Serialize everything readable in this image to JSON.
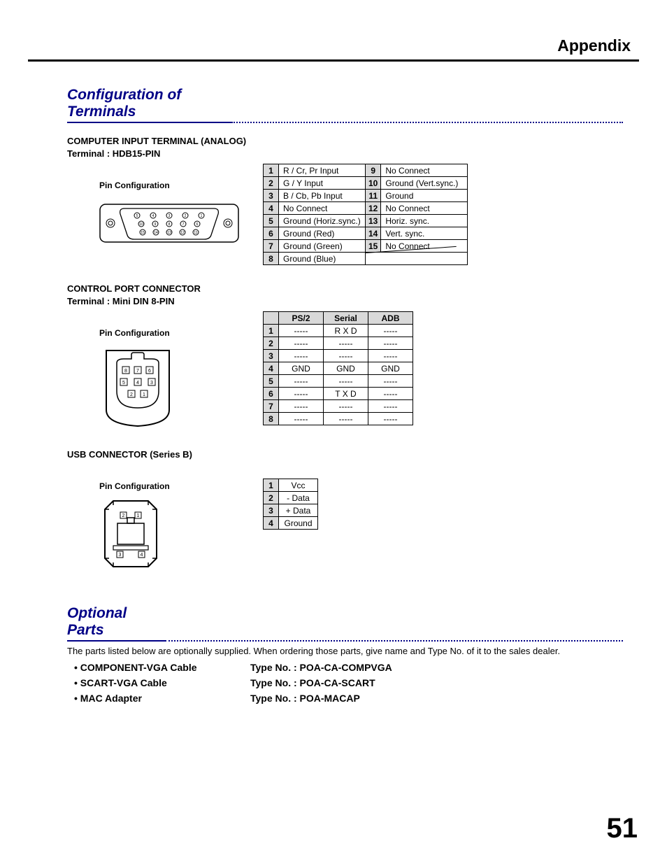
{
  "header": {
    "appendix": "Appendix"
  },
  "section1": {
    "title": "Configuration of Terminals",
    "computerInput": {
      "heading": "COMPUTER INPUT TERMINAL (ANALOG)",
      "terminal": "Terminal : HDB15-PIN",
      "pinConfig": "Pin Configuration",
      "pins": [
        [
          "1",
          "R / Cr, Pr Input",
          "9",
          "No Connect"
        ],
        [
          "2",
          "G / Y Input",
          "10",
          "Ground (Vert.sync.)"
        ],
        [
          "3",
          "B / Cb, Pb Input",
          "11",
          "Ground"
        ],
        [
          "4",
          "No Connect",
          "12",
          "No Connect"
        ],
        [
          "5",
          "Ground (Horiz.sync.)",
          "13",
          "Horiz. sync."
        ],
        [
          "6",
          "Ground (Red)",
          "14",
          "Vert. sync."
        ],
        [
          "7",
          "Ground (Green)",
          "15",
          "No Connect"
        ],
        [
          "8",
          "Ground (Blue)",
          "",
          ""
        ]
      ]
    },
    "controlPort": {
      "heading": "CONTROL PORT CONNECTOR",
      "terminal": "Terminal : Mini DIN 8-PIN",
      "pinConfig": "Pin Configuration",
      "cols": [
        "PS/2",
        "Serial",
        "ADB"
      ],
      "rows": [
        [
          "1",
          "-----",
          "R X D",
          "-----"
        ],
        [
          "2",
          "-----",
          "-----",
          "-----"
        ],
        [
          "3",
          "-----",
          "-----",
          "-----"
        ],
        [
          "4",
          "GND",
          "GND",
          "GND"
        ],
        [
          "5",
          "-----",
          "-----",
          "-----"
        ],
        [
          "6",
          "-----",
          "T X D",
          "-----"
        ],
        [
          "7",
          "-----",
          "-----",
          "-----"
        ],
        [
          "8",
          "-----",
          "-----",
          "-----"
        ]
      ]
    },
    "usb": {
      "heading": "USB CONNECTOR (Series B)",
      "pinConfig": "Pin Configuration",
      "rows": [
        [
          "1",
          "Vcc"
        ],
        [
          "2",
          "- Data"
        ],
        [
          "3",
          "+ Data"
        ],
        [
          "4",
          "Ground"
        ]
      ]
    }
  },
  "section2": {
    "title": "Optional Parts",
    "intro": "The parts listed below are optionally supplied.  When ordering those parts, give name and Type No. of it to the sales dealer.",
    "items": [
      {
        "name": "COMPONENT-VGA Cable",
        "type": "Type No.  :  POA-CA-COMPVGA"
      },
      {
        "name": "SCART-VGA Cable",
        "type": "Type No.  :  POA-CA-SCART"
      },
      {
        "name": "MAC Adapter",
        "type": "Type No.  :  POA-MACAP"
      }
    ]
  },
  "pageNumber": "51"
}
